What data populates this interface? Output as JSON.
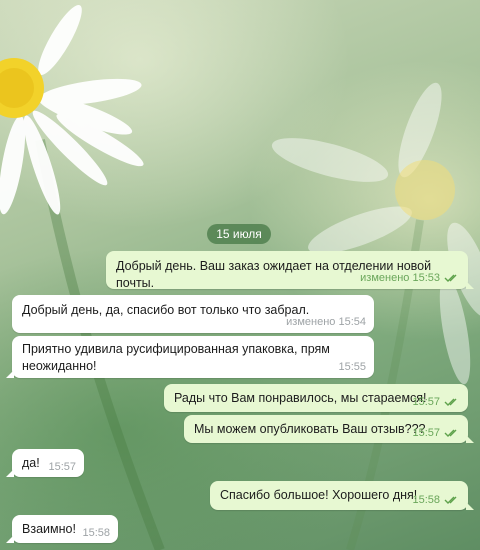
{
  "date_separator": "15 июля",
  "messages": [
    {
      "direction": "out",
      "text": "Добрый день. Ваш заказ ожидает на отделении новой почты.",
      "time": "изменено 15:53",
      "read": true
    },
    {
      "direction": "in",
      "text": "Добрый день, да, спасибо вот только что забрал.",
      "time": "изменено 15:54"
    },
    {
      "direction": "in",
      "text_line1": "Приятно удивила русифицированная упаковка, прям",
      "text_line2": "неожиданно!",
      "time": "15:55"
    },
    {
      "direction": "out",
      "text": "Рады что Вам понравилось, мы стараемся!",
      "time": "15:57",
      "read": true
    },
    {
      "direction": "out",
      "text": "Мы можем опубликовать Ваш отзыв???",
      "time": "15:57",
      "read": true
    },
    {
      "direction": "in",
      "text": "да!",
      "time": "15:57"
    },
    {
      "direction": "out",
      "text": "Спасибо большое! Хорошего дня!",
      "time": "15:58",
      "read": true
    },
    {
      "direction": "in",
      "text": "Взаимно!",
      "time": "15:58"
    }
  ],
  "colors": {
    "outgoing_bubble": "#e7f8d2",
    "incoming_bubble": "#ffffff",
    "read_ticks": "#5fa24c",
    "date_pill": "#5a8c5a"
  },
  "icons": {
    "read_receipt": "double-check-icon"
  }
}
